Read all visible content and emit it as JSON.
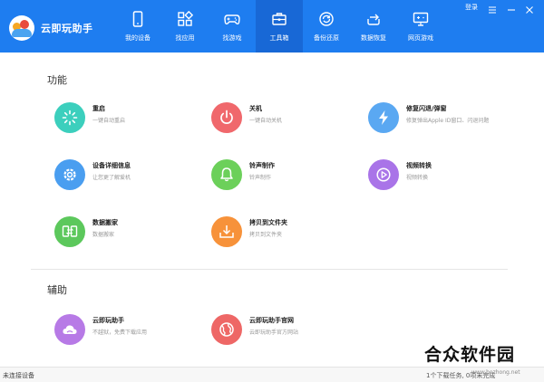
{
  "app": {
    "title": "云即玩助手"
  },
  "window": {
    "login_label": "登录"
  },
  "nav": [
    {
      "label": "我的设备",
      "icon": "phone-icon"
    },
    {
      "label": "找应用",
      "icon": "apps-icon"
    },
    {
      "label": "找游戏",
      "icon": "gamepad-icon"
    },
    {
      "label": "工具箱",
      "icon": "toolbox-icon",
      "active": true
    },
    {
      "label": "备份还原",
      "icon": "backup-icon"
    },
    {
      "label": "数据恢复",
      "icon": "restore-icon"
    },
    {
      "label": "网页游戏",
      "icon": "web-game-icon"
    }
  ],
  "sections": {
    "functions": {
      "title": "功能",
      "tools": [
        {
          "name": "重启",
          "desc": "一键自动重启",
          "icon": "restart-icon",
          "color": "#3ccfbd"
        },
        {
          "name": "关机",
          "desc": "一键自动关机",
          "icon": "power-icon",
          "color": "#f0686c"
        },
        {
          "name": "修复闪退/弹窗",
          "desc": "修复弹出Apple ID窗口、闪退问题",
          "icon": "lightning-icon",
          "color": "#5aa8f2"
        },
        {
          "name": "设备详细信息",
          "desc": "让您更了解爱机",
          "icon": "settings-icon",
          "color": "#4a9ef0"
        },
        {
          "name": "铃声制作",
          "desc": "铃声制作",
          "icon": "bell-icon",
          "color": "#6cd05a"
        },
        {
          "name": "视频转换",
          "desc": "视频转换",
          "icon": "play-icon",
          "color": "#a974e8"
        },
        {
          "name": "数据搬家",
          "desc": "数据搬家",
          "icon": "transfer-icon",
          "color": "#5cc85c"
        },
        {
          "name": "拷贝到文件夹",
          "desc": "拷贝到文件夹",
          "icon": "copy-folder-icon",
          "color": "#f7923a"
        }
      ]
    },
    "assist": {
      "title": "辅助",
      "tools": [
        {
          "name": "云即玩助手",
          "desc": "不越狱，免费下载应用",
          "icon": "cloud-icon",
          "color": "#b77ae6"
        },
        {
          "name": "云即玩助手官网",
          "desc": "云即玩助手官方网站",
          "icon": "globe-icon",
          "color": "#ee6766"
        }
      ]
    }
  },
  "status": {
    "left": "未连接设备",
    "right": "1个下载任务, 0项未完成"
  },
  "watermark": {
    "text": "合众软件园",
    "url": "www.hezhong.net"
  }
}
